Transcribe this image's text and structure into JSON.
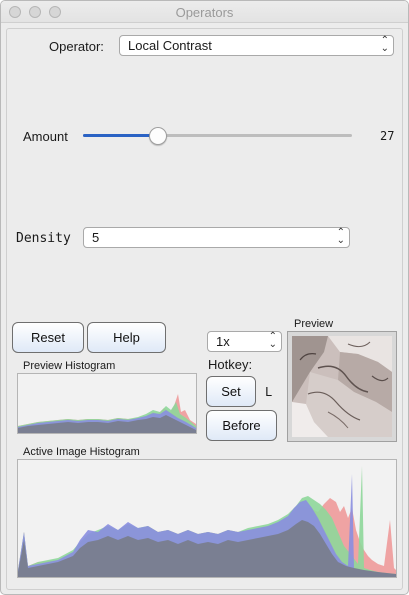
{
  "window": {
    "title": "Operators"
  },
  "operator": {
    "label": "Operator:",
    "selected": "Local Contrast"
  },
  "amount": {
    "label": "Amount",
    "value": "27",
    "fraction": 0.28
  },
  "density": {
    "label": "Density",
    "selected": "5"
  },
  "buttons": {
    "reset": "Reset",
    "help": "Help",
    "set": "Set",
    "before": "Before"
  },
  "zoom": {
    "selected": "1x"
  },
  "hotkey": {
    "label": "Hotkey:",
    "key": "L"
  },
  "preview": {
    "label": "Preview"
  },
  "preview_histogram": {
    "label": "Preview Histogram"
  },
  "active_histogram": {
    "label": "Active Image Histogram"
  },
  "colors": {
    "accent": "#2a62c4",
    "hist_gray": "#7a7f92",
    "hist_blue": "#8a8ee0",
    "hist_green": "#8ed79a",
    "hist_red": "#ee9a9a"
  },
  "icons": {
    "updown": "chevron-updown-icon"
  }
}
